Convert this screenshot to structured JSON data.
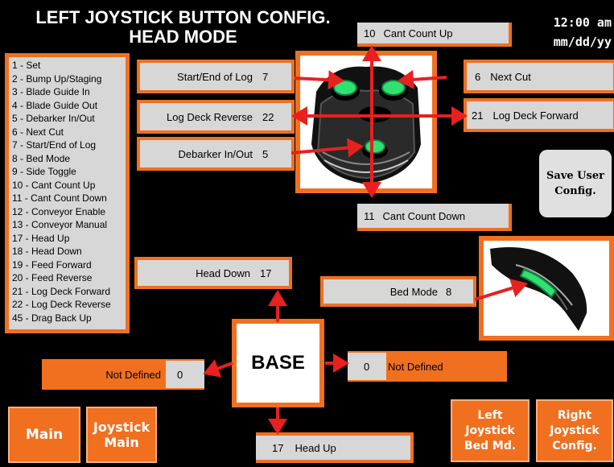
{
  "header": {
    "title_line1": "LEFT JOYSTICK BUTTON CONFIG.",
    "title_line2": "HEAD MODE",
    "time": "12:00 am",
    "date": "mm/dd/yy"
  },
  "legend": [
    "1 - Set",
    "2 - Bump Up/Staging",
    "3 - Blade Guide In",
    "4 - Blade Guide Out",
    "5 - Debarker In/Out",
    "6 - Next Cut",
    "7 - Start/End of Log",
    "8 - Bed Mode",
    "9 - Side Toggle",
    "10 - Cant Count Up",
    "11 - Cant Count Down",
    "12 - Conveyor Enable",
    "13 - Conveyor Manual",
    "17 - Head Up",
    "18 - Head Down",
    "19 - Feed Forward",
    "20 - Feed Reverse",
    "21 - Log Deck Forward",
    "22 - Log Deck Reverse",
    "45 - Drag Back Up"
  ],
  "joystick": {
    "top": {
      "num": "10",
      "label": "Cant Count Up"
    },
    "bottom": {
      "num": "11",
      "label": "Cant Count Down"
    },
    "start_end": {
      "label": "Start/End of Log",
      "num": "7"
    },
    "deck_reverse": {
      "label": "Log Deck Reverse",
      "num": "22"
    },
    "debarker": {
      "label": "Debarker In/Out",
      "num": "5"
    },
    "next_cut": {
      "num": "6",
      "label": "Next Cut"
    },
    "deck_forward": {
      "num": "21",
      "label": "Log Deck Forward"
    }
  },
  "bed": {
    "label": "Bed Mode",
    "num": "8"
  },
  "base": {
    "title": "BASE",
    "up": {
      "label": "Head Down",
      "num": "17"
    },
    "down": {
      "num": "17",
      "label": "Head Up"
    },
    "left": {
      "label": "Not Defined",
      "num": "0"
    },
    "right": {
      "num": "0",
      "label": "Not Defined"
    }
  },
  "buttons": {
    "save": "Save User Config.",
    "main": "Main",
    "joystick_main": "Joystick Main",
    "left_bed": "Left Joystick Bed Md.",
    "right_config": "Right Joystick Config."
  },
  "colors": {
    "accent": "#f07020",
    "button_green": "#30e070",
    "arrow": "#e82020"
  }
}
